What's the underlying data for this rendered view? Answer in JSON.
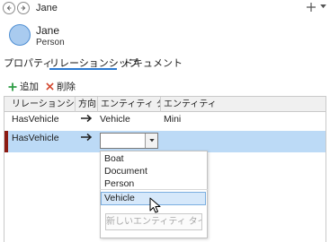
{
  "window": {
    "title": "Jane"
  },
  "header": {
    "name": "Jane",
    "type": "Person"
  },
  "tabs": [
    {
      "label": "プロパティ"
    },
    {
      "label": "リレーションシップ",
      "selected": true
    },
    {
      "label": "ドキュメント"
    }
  ],
  "toolbar": {
    "add_label": "追加",
    "delete_label": "削除"
  },
  "table": {
    "columns": [
      "リレーションシップ",
      "方向",
      "エンティティ タイプ",
      "エンティティ"
    ],
    "rows": [
      {
        "relationship": "HasVehicle",
        "direction": "→",
        "entity_type": "Vehicle",
        "entity": "Mini"
      },
      {
        "relationship": "HasVehicle",
        "direction": "→",
        "entity_type": "",
        "entity": ""
      }
    ]
  },
  "dropdown": {
    "options": [
      "Boat",
      "Document",
      "Person",
      "Vehicle"
    ],
    "highlighted": "Vehicle",
    "new_button_label": "新しいエンティティ タイプ"
  },
  "colors": {
    "accent": "#2b79d0",
    "selected_row": "#bcdaf6",
    "row_marker": "#8b1a12",
    "add_icon": "#2e9d45",
    "delete_icon": "#d2452c",
    "avatar": "#a9cbef"
  }
}
